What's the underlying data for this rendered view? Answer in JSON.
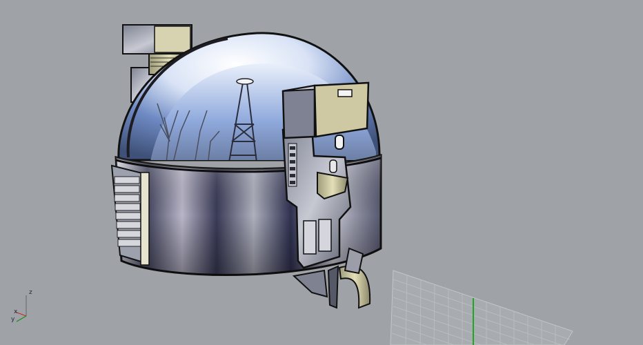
{
  "viewport": {
    "background": "#9fa3a7",
    "grid_color": "#b8bcbf",
    "grid_axis_color": "#1ea81e"
  },
  "axis_widget": {
    "z_label": "z",
    "x_label": "x",
    "y_label": "y",
    "colors": {
      "z": "#6b6f73",
      "x": "#c12a2a",
      "y": "#1b8b1b"
    }
  },
  "model": {
    "icon": "helmet-model-icon",
    "colors": {
      "dome_light": "#eef2f9",
      "dome_sky": "#5c79b6",
      "band_dark": "#3c3e5c",
      "metal": "#b9bbc4",
      "accent_brass": "#cfc89b"
    }
  }
}
